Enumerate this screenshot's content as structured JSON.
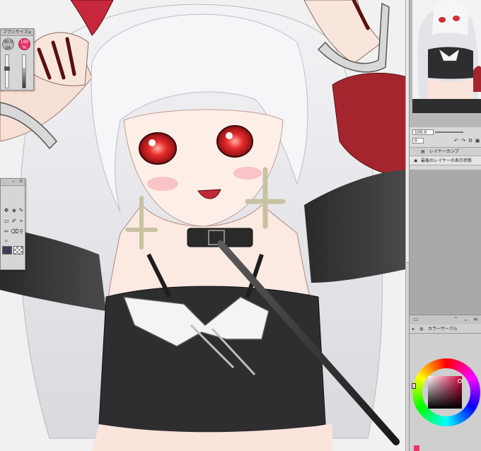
{
  "brush_palette": {
    "title": "ブラシサイズ",
    "close_glyph": "×",
    "size_a": "30.0",
    "size_a_unit": "px",
    "size_b": "100",
    "size_b_unit": "%"
  },
  "tool_palette": {
    "minimize_glyph": "–",
    "close_glyph": "×"
  },
  "layer_panel": {
    "opacity": "100.0",
    "blend": "0",
    "layer_comp_label": "レイヤーカンプ",
    "status_text": "最後のレイヤーの表示状態"
  },
  "color_panel": {
    "title": "カラーサークル",
    "accent": "#e8366a"
  },
  "icons": [
    "close-icon",
    "eye-icon",
    "pen-icon",
    "fill-icon",
    "eyedropper-icon",
    "zoom-icon",
    "move-icon",
    "undo-icon",
    "redo-icon",
    "chevron-up-icon",
    "chevron-down-icon"
  ]
}
